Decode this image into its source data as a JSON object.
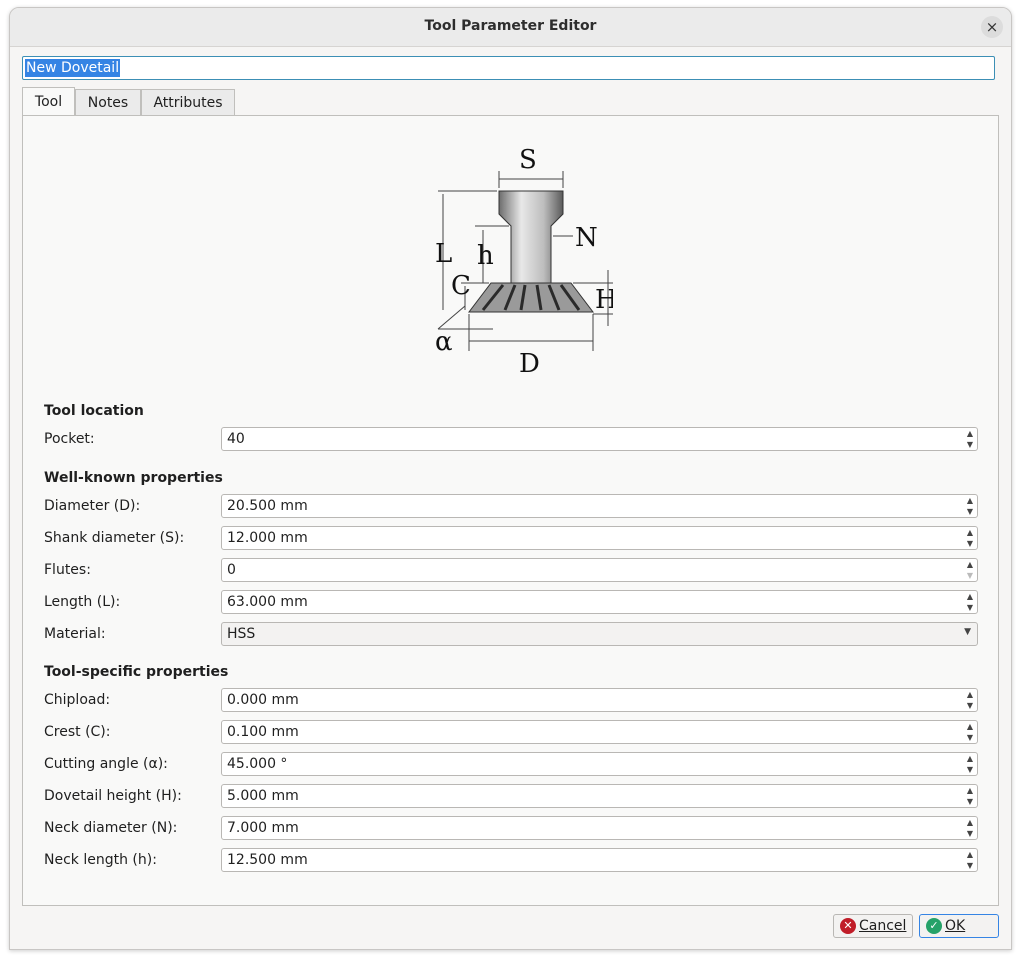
{
  "window": {
    "title": "Tool Parameter Editor",
    "close_symbol": "×"
  },
  "tool_name": "New Dovetail",
  "tabs": [
    {
      "label": "Tool",
      "active": true
    },
    {
      "label": "Notes",
      "active": false
    },
    {
      "label": "Attributes",
      "active": false
    }
  ],
  "diagram": {
    "labels": {
      "S": "S",
      "N": "N",
      "L": "L",
      "h": "h",
      "C": "C",
      "H": "H",
      "alpha": "α",
      "D": "D"
    }
  },
  "sections": {
    "location": "Tool location",
    "wellknown": "Well-known properties",
    "specific": "Tool-specific properties"
  },
  "fields": {
    "pocket": {
      "label": "Pocket:",
      "value": "40"
    },
    "diameter": {
      "label": "Diameter (D):",
      "value": "20.500 mm"
    },
    "shank_diameter": {
      "label": "Shank diameter (S):",
      "value": "12.000 mm"
    },
    "flutes": {
      "label": "Flutes:",
      "value": "0"
    },
    "length": {
      "label": "Length (L):",
      "value": "63.000 mm"
    },
    "material": {
      "label": "Material:",
      "value": "HSS"
    },
    "chipload": {
      "label": "Chipload:",
      "value": "0.000 mm"
    },
    "crest": {
      "label": "Crest (C):",
      "value": "0.100 mm"
    },
    "cutting_angle": {
      "label": "Cutting angle (α):",
      "value": "45.000 °"
    },
    "dovetail_height": {
      "label": "Dovetail height (H):",
      "value": "5.000 mm"
    },
    "neck_diameter": {
      "label": "Neck diameter (N):",
      "value": "7.000 mm"
    },
    "neck_length": {
      "label": "Neck length (h):",
      "value": "12.500 mm"
    }
  },
  "buttons": {
    "cancel": "Cancel",
    "ok": "OK"
  },
  "colors": {
    "accent": "#3584e4",
    "cancel_icon": "#c01c28",
    "ok_icon": "#26a269",
    "ok_border": "#3584e4"
  }
}
